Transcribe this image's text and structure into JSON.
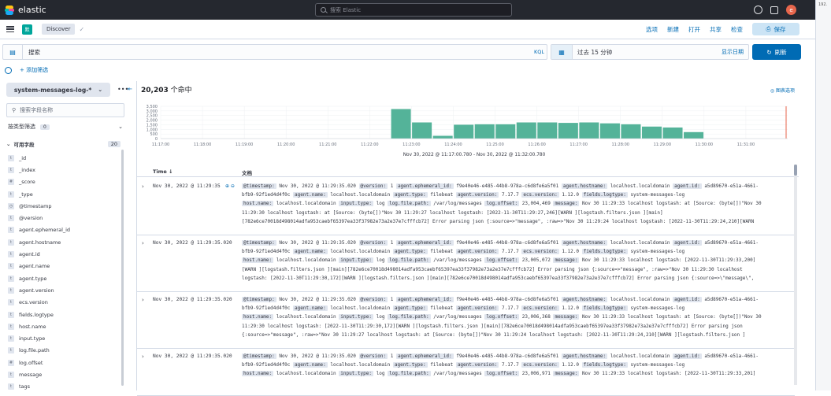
{
  "topbar": {
    "brand": "elastic",
    "search_placeholder": "搜索 Elastic",
    "avatar_letter": "e",
    "side_ip": "192."
  },
  "nav": {
    "space_badge": "默",
    "crumb": "Discover",
    "menu": [
      "选项",
      "新建",
      "打开",
      "共享",
      "检查"
    ],
    "save": "保存"
  },
  "query": {
    "menu_icon": "▤",
    "text": "搜索",
    "kql": "KQL",
    "time": "过去 15 分钟",
    "show_dates": "显示日期",
    "refresh": "刷新",
    "add_filter": "+ 添加筛选"
  },
  "sidebar": {
    "index": "system-messages-log-*",
    "field_search": "搜索字段名称",
    "filter_by_type": "按类型筛选",
    "filter_count": "0",
    "available": "可用字段",
    "available_count": "20",
    "fields": [
      {
        "t": "t",
        "n": "_id"
      },
      {
        "t": "t",
        "n": "_index"
      },
      {
        "t": "#",
        "n": "_score"
      },
      {
        "t": "t",
        "n": "_type"
      },
      {
        "t": "◷",
        "n": "@timestamp"
      },
      {
        "t": "t",
        "n": "@version"
      },
      {
        "t": "t",
        "n": "agent.ephemeral_id"
      },
      {
        "t": "t",
        "n": "agent.hostname"
      },
      {
        "t": "t",
        "n": "agent.id"
      },
      {
        "t": "t",
        "n": "agent.name"
      },
      {
        "t": "t",
        "n": "agent.type"
      },
      {
        "t": "t",
        "n": "agent.version"
      },
      {
        "t": "t",
        "n": "ecs.version"
      },
      {
        "t": "t",
        "n": "fields.logtype"
      },
      {
        "t": "t",
        "n": "host.name"
      },
      {
        "t": "t",
        "n": "input.type"
      },
      {
        "t": "t",
        "n": "log.file.path"
      },
      {
        "t": "#",
        "n": "log.offset"
      },
      {
        "t": "t",
        "n": "message"
      },
      {
        "t": "t",
        "n": "tags"
      }
    ]
  },
  "results": {
    "hits": "20,203",
    "hits_label": " 个命中",
    "chart_options": "◎ 图表选项",
    "range": "Nov 30, 2022 @ 11:17:00.780 - Nov 30, 2022 @ 11:32:00.780",
    "col_time": "Time ↓",
    "col_doc": "文档"
  },
  "rows": [
    {
      "time": "Nov 30, 2022 @ 11:29:35",
      "lines": [
        [
          [
            "@timestamp:",
            "Nov 30, 2022 @ 11:29:35.020"
          ],
          [
            "@version:",
            "1"
          ],
          [
            "agent.ephemeral_id:",
            "f9e40e46-e485-44b8-978a-c6d8fe6a5f01"
          ],
          [
            "agent.hostname:",
            "localhost.localdomain"
          ],
          [
            "agent.id:",
            "a5d89670-e51a-4661-"
          ]
        ],
        [
          [
            "",
            "bfb9-92f1ed4d4f0c"
          ],
          [
            "agent.name:",
            "localhost.localdomain"
          ],
          [
            "agent.type:",
            "filebeat"
          ],
          [
            "agent.version:",
            "7.17.7"
          ],
          [
            "ecs.version:",
            "1.12.0"
          ],
          [
            "fields.logtype:",
            "system-messages-log"
          ]
        ],
        [
          [
            "host.name:",
            "localhost.localdomain"
          ],
          [
            "input.type:",
            "log"
          ],
          [
            "log.file.path:",
            "/var/log/messages"
          ],
          [
            "log.offset:",
            "23,004,469"
          ],
          [
            "message:",
            "Nov 30 11:29:33 localhost logstash: at [Source: (byte[])\"Nov 30"
          ]
        ],
        [
          [
            "",
            "11:29:30 localhost logstash: at [Source: (byte[])\"Nov 30 11:29:27 localhost logstash: [2022-11-30T11:29:27,246][WARN ][logstash.filters.json ][main]"
          ]
        ],
        [
          [
            "",
            "[782e6ce70018d498014adfa953caebf65397ea33f37982e73a2e37e7cfffcb72] Error parsing json {:source=>\"message\", :raw=>\"Nov 30 11:29:24 localhost logstash: [2022-11-30T11:29:24,210][WARN"
          ]
        ]
      ]
    },
    {
      "time": "Nov 30, 2022 @ 11:29:35.020",
      "lines": [
        [
          [
            "@timestamp:",
            "Nov 30, 2022 @ 11:29:35.020"
          ],
          [
            "@version:",
            "1"
          ],
          [
            "agent.ephemeral_id:",
            "f9e40e46-e485-44b8-978a-c6d8fe6a5f01"
          ],
          [
            "agent.hostname:",
            "localhost.localdomain"
          ],
          [
            "agent.id:",
            "a5d89670-e51a-4661-"
          ]
        ],
        [
          [
            "",
            "bfb9-92f1ed4d4f0c"
          ],
          [
            "agent.name:",
            "localhost.localdomain"
          ],
          [
            "agent.type:",
            "filebeat"
          ],
          [
            "agent.version:",
            "7.17.7"
          ],
          [
            "ecs.version:",
            "1.12.0"
          ],
          [
            "fields.logtype:",
            "system-messages-log"
          ]
        ],
        [
          [
            "host.name:",
            "localhost.localdomain"
          ],
          [
            "input.type:",
            "log"
          ],
          [
            "log.file.path:",
            "/var/log/messages"
          ],
          [
            "log.offset:",
            "23,005,072"
          ],
          [
            "message:",
            "Nov 30 11:29:33 localhost logstash: [2022-11-30T11:29:33,200]"
          ]
        ],
        [
          [
            "",
            "[WARN ][logstash.filters.json ][main][782e6ce70018d498014adfa953caebf65397ea33f37982e73a2e37e7cfffcb72] Error parsing json {:source=>\"message\", :raw=>\"Nov 30 11:29:30 localhost"
          ]
        ],
        [
          [
            "",
            "logstash: [2022-11-30T11:29:30,172][WARN ][logstash.filters.json ][main][782e6ce70018d498014adfa953caebf65397ea33f37982e73a2e37e7cfffcb72] Error parsing json {:source=>\\\"message\\\","
          ]
        ]
      ]
    },
    {
      "time": "Nov 30, 2022 @ 11:29:35.020",
      "lines": [
        [
          [
            "@timestamp:",
            "Nov 30, 2022 @ 11:29:35.020"
          ],
          [
            "@version:",
            "1"
          ],
          [
            "agent.ephemeral_id:",
            "f9e40e46-e485-44b8-978a-c6d8fe6a5f01"
          ],
          [
            "agent.hostname:",
            "localhost.localdomain"
          ],
          [
            "agent.id:",
            "a5d89670-e51a-4661-"
          ]
        ],
        [
          [
            "",
            "bfb9-92f1ed4d4f0c"
          ],
          [
            "agent.name:",
            "localhost.localdomain"
          ],
          [
            "agent.type:",
            "filebeat"
          ],
          [
            "agent.version:",
            "7.17.7"
          ],
          [
            "ecs.version:",
            "1.12.0"
          ],
          [
            "fields.logtype:",
            "system-messages-log"
          ]
        ],
        [
          [
            "host.name:",
            "localhost.localdomain"
          ],
          [
            "input.type:",
            "log"
          ],
          [
            "log.file.path:",
            "/var/log/messages"
          ],
          [
            "log.offset:",
            "23,006,368"
          ],
          [
            "message:",
            "Nov 30 11:29:33 localhost logstash: at [Source: (byte[])\"Nov 30"
          ]
        ],
        [
          [
            "",
            "11:29:30 localhost logstash: [2022-11-30T11:29:30,172][WARN ][logstash.filters.json ][main][782e6ce70018d498014adfa953caebf65397ea33f37982e73a2e37e7cfffcb72] Error parsing json"
          ]
        ],
        [
          [
            "",
            "{:source=>\"message\", :raw=>\"Nov 30 11:29:27 localhost logstash: at [Source: (byte[])\"Nov 30 11:29:24 localhost logstash: [2022-11-30T11:29:24,210][WARN ][logstash.filters.json ]"
          ]
        ]
      ]
    },
    {
      "time": "Nov 30, 2022 @ 11:29:35.020",
      "lines": [
        [
          [
            "@timestamp:",
            "Nov 30, 2022 @ 11:29:35.020"
          ],
          [
            "@version:",
            "1"
          ],
          [
            "agent.ephemeral_id:",
            "f9e40e46-e485-44b8-978a-c6d8fe6a5f01"
          ],
          [
            "agent.hostname:",
            "localhost.localdomain"
          ],
          [
            "agent.id:",
            "a5d89670-e51a-4661-"
          ]
        ],
        [
          [
            "",
            "bfb9-92f1ed4d4f0c"
          ],
          [
            "agent.name:",
            "localhost.localdomain"
          ],
          [
            "agent.type:",
            "filebeat"
          ],
          [
            "agent.version:",
            "7.17.7"
          ],
          [
            "ecs.version:",
            "1.12.0"
          ],
          [
            "fields.logtype:",
            "system-messages-log"
          ]
        ],
        [
          [
            "host.name:",
            "localhost.localdomain"
          ],
          [
            "input.type:",
            "log"
          ],
          [
            "log.file.path:",
            "/var/log/messages"
          ],
          [
            "log.offset:",
            "23,006,971"
          ],
          [
            "message:",
            "Nov 30 11:29:33 localhost logstash: [2022-11-30T11:29:33,201]"
          ]
        ]
      ]
    }
  ],
  "chart_data": {
    "type": "bar",
    "title": "",
    "xlabel": "Nov 30, 2022 @ 11:17:00.780 - Nov 30, 2022 @ 11:32:00.780",
    "ylabel": "",
    "ylim": [
      0,
      3500
    ],
    "yticks": [
      "3,500",
      "3,000",
      "2,500",
      "2,000",
      "1,500",
      "1,000",
      "500",
      "0"
    ],
    "xticks": [
      "11:17:00",
      "11:18:00",
      "11:19:00",
      "11:20:00",
      "11:21:00",
      "11:22:00",
      "11:23:00",
      "11:24:00",
      "11:25:00",
      "11:26:00",
      "11:27:00",
      "11:28:00",
      "11:29:00",
      "11:30:00",
      "11:31:00"
    ],
    "x": [
      "11:22:30",
      "11:23:00",
      "11:23:30",
      "11:24:00",
      "11:24:30",
      "11:25:00",
      "11:25:30",
      "11:26:00",
      "11:26:30",
      "11:27:00",
      "11:27:30",
      "11:28:00",
      "11:28:30",
      "11:29:00",
      "11:29:30"
    ],
    "values": [
      3200,
      1750,
      300,
      1500,
      1550,
      1550,
      1750,
      1750,
      1700,
      1750,
      1650,
      1550,
      1300,
      1200,
      700
    ],
    "bar_color": "#54b399"
  }
}
